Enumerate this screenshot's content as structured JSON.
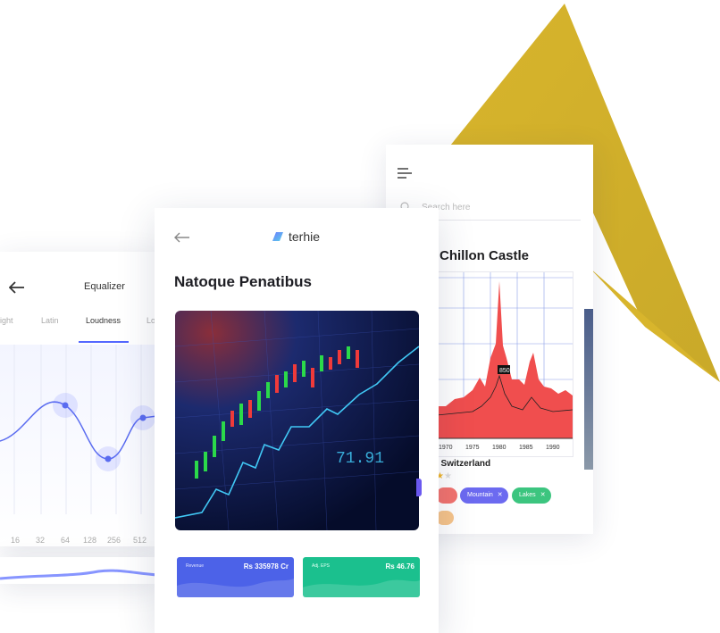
{
  "equalizer": {
    "title": "Equalizer",
    "tabs": [
      "ight",
      "Latin",
      "Loudness",
      "Lo"
    ],
    "frequencies": [
      "16",
      "32",
      "64",
      "128",
      "256",
      "512"
    ]
  },
  "main": {
    "logo_text": "terhie",
    "title": "Natoque Penatibus",
    "hero_text": "71.91",
    "stats": [
      {
        "label": "Revenue",
        "value": "Rs 335978 Cr",
        "color": "#4c62e8"
      },
      {
        "label": "Adj. EPS",
        "value": "Rs 46.76",
        "color": "#1bc08e"
      }
    ]
  },
  "travel": {
    "search_placeholder": "Search here",
    "title": "Chillon Castle",
    "location": ", Switzerland",
    "tags": [
      "Mountain",
      "Lakes"
    ],
    "chart_badge": "850",
    "chart_xticks": [
      "1970",
      "1975",
      "1980",
      "1985",
      "1990"
    ]
  },
  "colors": {
    "accent": "#5468ff",
    "gold": "#d9b830",
    "chart_red": "#f04e4e"
  }
}
